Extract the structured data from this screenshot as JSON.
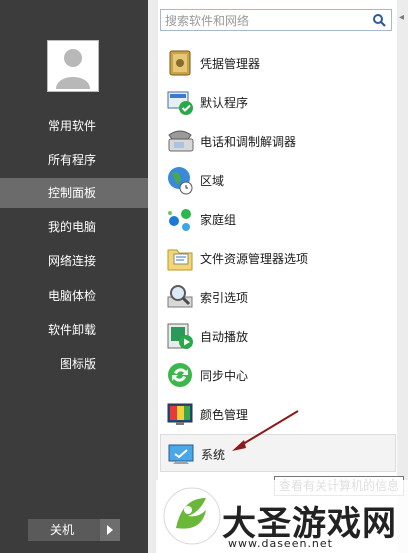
{
  "search": {
    "placeholder": "搜索软件和网络"
  },
  "sidebar": {
    "items": [
      {
        "label": "常用软件"
      },
      {
        "label": "所有程序"
      },
      {
        "label": "控制面板"
      },
      {
        "label": "我的电脑"
      },
      {
        "label": "网络连接"
      },
      {
        "label": "电脑体检"
      },
      {
        "label": "软件卸载"
      },
      {
        "label": "图标版"
      }
    ],
    "active_index": 2,
    "shutdown_label": "关机"
  },
  "items": [
    {
      "label": "凭据管理器",
      "icon": "safe-icon"
    },
    {
      "label": "默认程序",
      "icon": "default-programs-icon"
    },
    {
      "label": "电话和调制解调器",
      "icon": "phone-modem-icon"
    },
    {
      "label": "区域",
      "icon": "globe-clock-icon"
    },
    {
      "label": "家庭组",
      "icon": "homegroup-icon"
    },
    {
      "label": "文件资源管理器选项",
      "icon": "folder-options-icon"
    },
    {
      "label": "索引选项",
      "icon": "index-magnifier-icon"
    },
    {
      "label": "自动播放",
      "icon": "autoplay-icon"
    },
    {
      "label": "同步中心",
      "icon": "sync-center-icon"
    },
    {
      "label": "颜色管理",
      "icon": "color-management-icon"
    },
    {
      "label": "系统",
      "icon": "system-monitor-icon"
    }
  ],
  "tooltip": "查看有关计算机的信息",
  "watermark": {
    "title": "大圣游戏网",
    "url": "www.daseen.net"
  },
  "colors": {
    "sidebar": "#3c3c3c",
    "sidebar_active": "#6b6b6b",
    "search_border": "#a8b8cc",
    "arrow": "#8b1a1a"
  }
}
